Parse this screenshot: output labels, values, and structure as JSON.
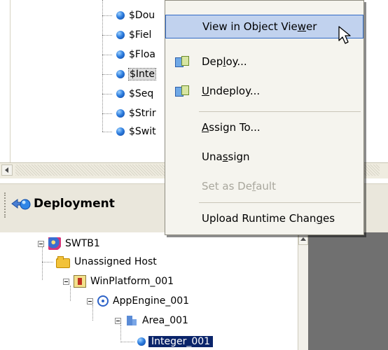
{
  "top_tree": {
    "items": [
      {
        "label": "$Dou"
      },
      {
        "label": "$Fiel"
      },
      {
        "label": "$Floa"
      },
      {
        "label": "$Inte"
      },
      {
        "label": "$Seq"
      },
      {
        "label": "$Strir"
      },
      {
        "label": "$Swit"
      }
    ]
  },
  "deployment": {
    "title": "Deployment",
    "tree": [
      {
        "label": "SWTB1"
      },
      {
        "label": "Unassigned Host"
      },
      {
        "label": "WinPlatform_001"
      },
      {
        "label": "AppEngine_001"
      },
      {
        "label": "Area_001"
      },
      {
        "label": "Integer_001"
      }
    ]
  },
  "context_menu": {
    "view_in_object_viewer": {
      "pre": "View in Object Vie",
      "ul": "w",
      "post": "er"
    },
    "deploy": {
      "pre": "Dep",
      "ul": "l",
      "post": "oy..."
    },
    "undeploy": {
      "pre": "",
      "ul": "U",
      "post": "ndeploy..."
    },
    "assign_to": {
      "pre": "",
      "ul": "A",
      "post": "ssign To..."
    },
    "unassign": {
      "pre": "Una",
      "ul": "s",
      "post": "sign"
    },
    "set_as_default": {
      "pre": "Set as De",
      "ul": "f",
      "post": "ault"
    },
    "upload_runtime_changes": {
      "pre": "Upload Runtime Chan",
      "ul": "g",
      "post": "es"
    }
  },
  "colors": {
    "selection": "#0a246a",
    "menu_hover": "#c1d2ee",
    "menu_border": "#316ac5",
    "pane_gray": "#707070"
  }
}
